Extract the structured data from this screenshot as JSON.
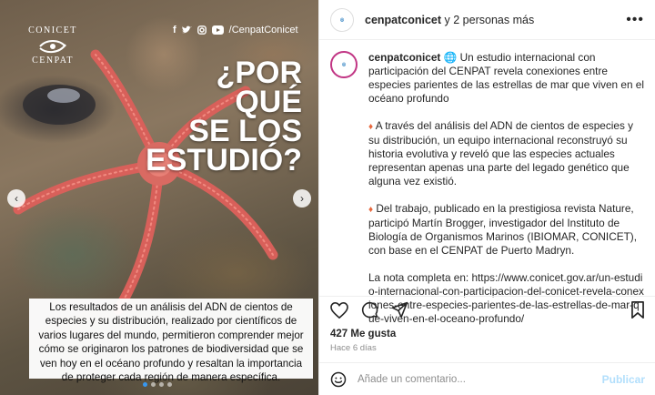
{
  "media": {
    "logo": {
      "top": "CONICET",
      "bottom": "CENPAT"
    },
    "social_handle": "/CenpatConicet",
    "headline": [
      "¿POR",
      "QUÉ",
      "SE LOS",
      "ESTUDIÓ?"
    ],
    "caption": "Los resultados de un análisis del ADN de cientos de especies y su distribución, realizado por científicos de varios lugares del mundo, permitieron comprender mejor cómo se originaron los patrones de biodiversidad que se ven hoy en el océano profundo y resaltan la importancia de proteger cada región de manera específica.",
    "carousel": {
      "total": 4,
      "active": 1
    }
  },
  "header": {
    "username": "cenpatconicet",
    "collab": " y 2 personas más"
  },
  "post": {
    "username": "cenpatconicet",
    "intro": " Un estudio internacional con participación del CENPAT revela conexiones entre especies parientes de las estrellas de mar que viven en el océano profundo",
    "paragraph2": " A través del análisis del ADN de cientos de especies y su distribución, un equipo internacional reconstruyó su historia evolutiva y reveló que las especies actuales representan apenas una parte del legado genético que alguna vez existió.",
    "paragraph3": " Del trabajo, publicado en la prestigiosa revista Nature, participó Martín Brogger, investigador del Instituto de Biología de Organismos Marinos (IBIOMAR, CONICET), con base en el CENPAT de Puerto Madryn.",
    "paragraph4": "La nota completa en: https://www.conicet.gov.ar/un-estudio-internacional-con-participacion-del-conicet-revela-conexiones-entre-especies-parientes-de-las-estrellas-de-mar-que-viven-en-el-oceano-profundo/"
  },
  "likes": "427 Me gusta",
  "time_ago": "Hace 6 días",
  "comment_box": {
    "placeholder": "Añade un comentario...",
    "publish_label": "Publicar"
  },
  "colors": {
    "accent": "#3897f0",
    "publish_disabled": "#b2dffc",
    "text": "#262626",
    "muted": "#8e8e8e"
  }
}
